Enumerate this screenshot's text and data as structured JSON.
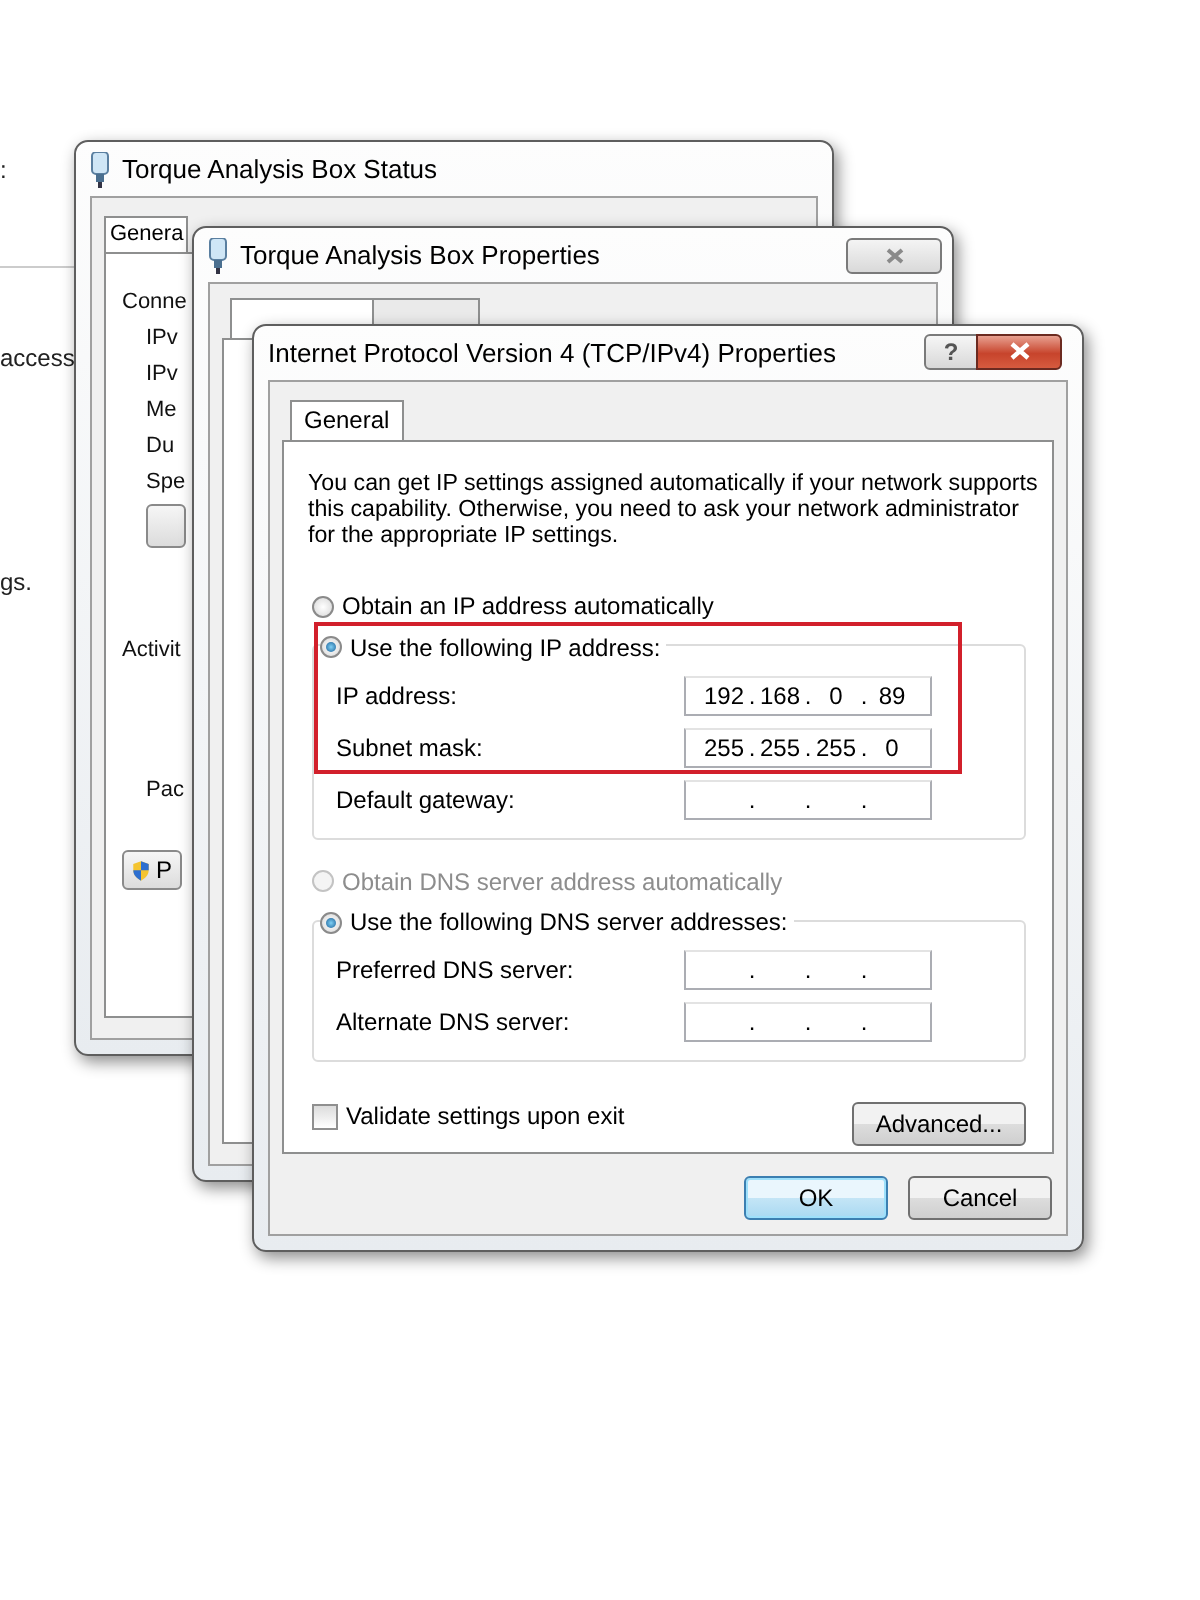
{
  "background": {
    "texts": [
      ":",
      "access",
      "gs."
    ]
  },
  "status_window": {
    "title": "Torque Analysis Box Status",
    "tabs": [
      {
        "label": "Genera",
        "selected": true
      }
    ],
    "labels": [
      {
        "text": "Conne",
        "kind": "heading"
      },
      {
        "text": "IPv",
        "kind": "item"
      },
      {
        "text": "IPv",
        "kind": "item"
      },
      {
        "text": "Me",
        "kind": "item"
      },
      {
        "text": "Du",
        "kind": "item"
      },
      {
        "text": "Spe",
        "kind": "item"
      },
      {
        "text": "Activit",
        "kind": "heading"
      },
      {
        "text": "Pac",
        "kind": "item"
      }
    ],
    "shield_button": "P"
  },
  "properties_window": {
    "title": "Torque Analysis Box Properties",
    "tabs": [
      {
        "selected": true
      },
      {
        "selected": false
      }
    ]
  },
  "ipv4_dialog": {
    "title": "Internet Protocol Version 4 (TCP/IPv4) Properties",
    "help": "?",
    "tabs": [
      {
        "label": "General",
        "selected": true
      }
    ],
    "description": "You can get IP settings assigned automatically if your network supports this capability. Otherwise, you need to ask your network administrator for the appropriate IP settings.",
    "ip_mode": [
      {
        "label": "Obtain an IP address automatically",
        "selected": false,
        "disabled": false
      },
      {
        "label": "Use the following IP address:",
        "selected": true,
        "disabled": false
      }
    ],
    "ip_fields": [
      {
        "label": "IP address:",
        "value": "192 . 168 . 0 . 89"
      },
      {
        "label": "Subnet mask:",
        "value": "255 . 255 . 255 . 0"
      },
      {
        "label": "Default gateway:",
        "value": ". . ."
      }
    ],
    "dns_mode": [
      {
        "label": "Obtain DNS server address automatically",
        "selected": false,
        "disabled": true
      },
      {
        "label": "Use the following DNS server addresses:",
        "selected": true,
        "disabled": false
      }
    ],
    "dns_fields": [
      {
        "label": "Preferred DNS server:",
        "value": ". . ."
      },
      {
        "label": "Alternate DNS server:",
        "value": ". . ."
      }
    ],
    "validate": {
      "label": "Validate settings upon exit",
      "checked": false
    },
    "advanced_button": "Advanced...",
    "buttons": [
      {
        "label": "OK",
        "default": true
      },
      {
        "label": "Cancel",
        "default": false
      }
    ]
  }
}
